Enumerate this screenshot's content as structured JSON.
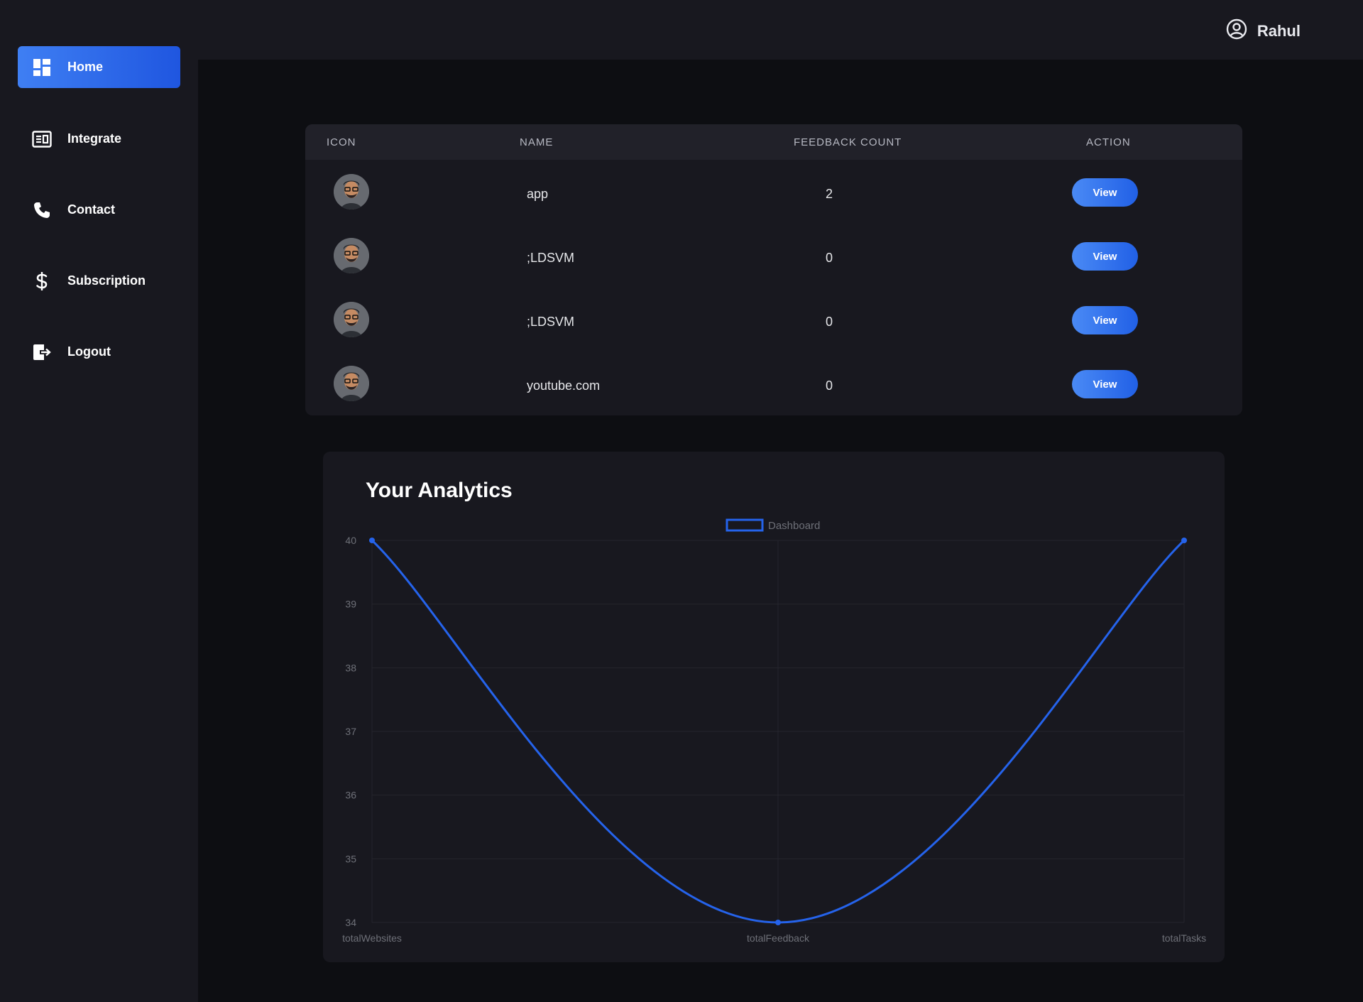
{
  "sidebar": {
    "items": [
      {
        "label": "Home",
        "icon": "dashboard-icon",
        "active": true
      },
      {
        "label": "Integrate",
        "icon": "integrate-icon",
        "active": false
      },
      {
        "label": "Contact",
        "icon": "phone-icon",
        "active": false
      },
      {
        "label": "Subscription",
        "icon": "dollar-icon",
        "active": false
      },
      {
        "label": "Logout",
        "icon": "logout-icon",
        "active": false
      }
    ]
  },
  "header": {
    "user_name": "Rahul",
    "user_icon": "user-circle-icon"
  },
  "table": {
    "columns": [
      "ICON",
      "NAME",
      "FEEDBACK COUNT",
      "ACTION"
    ],
    "rows": [
      {
        "name": "app",
        "feedback_count": "2",
        "action": "View"
      },
      {
        "name": ";LDSVM",
        "feedback_count": "0",
        "action": "View"
      },
      {
        "name": ";LDSVM",
        "feedback_count": "0",
        "action": "View"
      },
      {
        "name": "youtube.com",
        "feedback_count": "0",
        "action": "View"
      }
    ]
  },
  "analytics": {
    "title": "Your Analytics"
  },
  "colors": {
    "accent": "#2563eb",
    "background": "#0d0e12",
    "panel": "#18181f"
  },
  "chart_data": {
    "type": "line",
    "title": "Your Analytics",
    "categories": [
      "totalWebsites",
      "totalFeedback",
      "totalTasks"
    ],
    "series": [
      {
        "name": "Dashboard",
        "values": [
          40,
          34,
          40
        ],
        "color": "#2563eb"
      }
    ],
    "yticks": [
      34,
      35,
      36,
      37,
      38,
      39,
      40
    ],
    "ylim": [
      34,
      40
    ],
    "grid": true,
    "legend": "top-center",
    "xlabel": "",
    "ylabel": ""
  }
}
